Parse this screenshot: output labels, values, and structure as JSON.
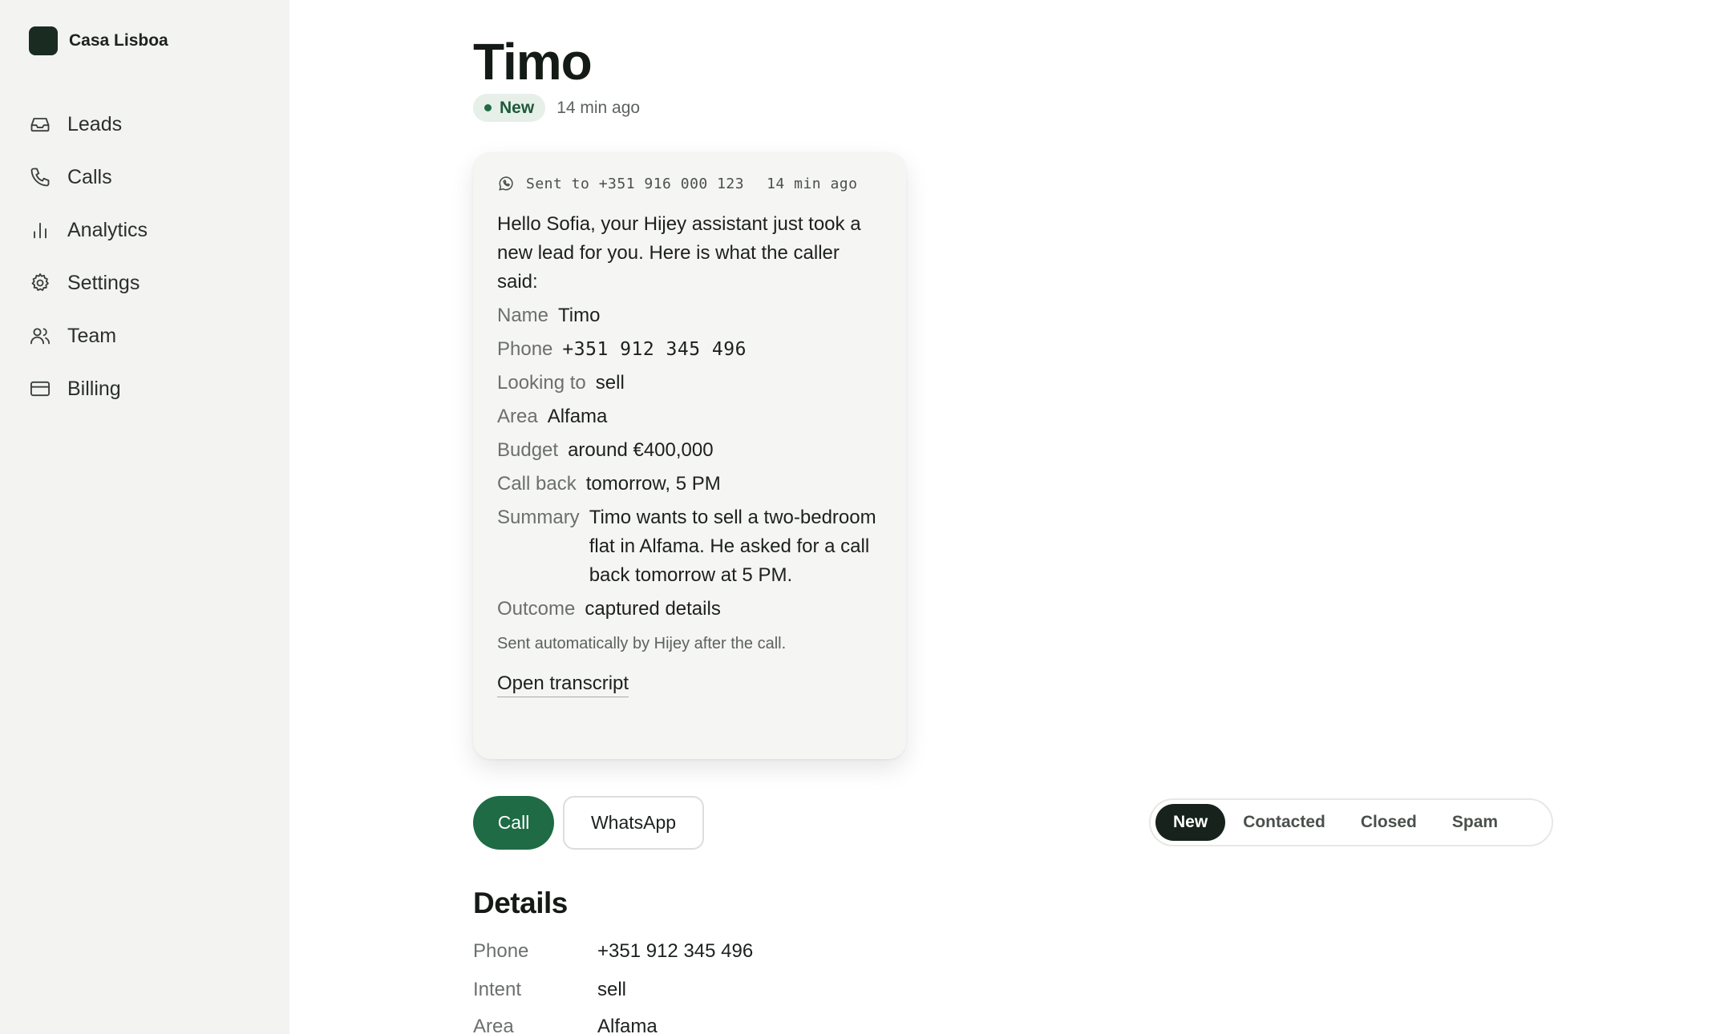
{
  "brand": {
    "name": "Casa Lisboa"
  },
  "nav": [
    {
      "label": "Leads",
      "icon": "inbox-icon"
    },
    {
      "label": "Calls",
      "icon": "phone-icon"
    },
    {
      "label": "Analytics",
      "icon": "bar-chart-icon"
    },
    {
      "label": "Settings",
      "icon": "gear-icon"
    },
    {
      "label": "Team",
      "icon": "users-icon"
    },
    {
      "label": "Billing",
      "icon": "credit-card-icon"
    }
  ],
  "lead": {
    "name": "Timo",
    "status": "New",
    "time_ago": "14 min ago"
  },
  "message": {
    "sent_to": "Sent to +351 916 000 123",
    "time": "14 min ago",
    "intro": "Hello Sofia, your Hijey assistant just took a new lead for you. Here is what the caller said:",
    "fields": [
      {
        "label": "Name",
        "value": "Timo"
      },
      {
        "label": "Phone",
        "value": "+351 912 345 496"
      },
      {
        "label": "Looking to",
        "value": "sell"
      },
      {
        "label": "Area",
        "value": "Alfama"
      },
      {
        "label": "Budget",
        "value": "around €400,000"
      },
      {
        "label": "Call back",
        "value": "tomorrow, 5 PM"
      },
      {
        "label": "Summary",
        "value": "Timo wants to sell a two-bedroom flat in Alfama. He asked for a call back tomorrow at 5 PM."
      },
      {
        "label": "Outcome",
        "value": "captured details"
      }
    ],
    "note": "Sent automatically by Hijey after the call.",
    "link": "Open transcript"
  },
  "actions": {
    "call": "Call",
    "whatsapp": "WhatsApp"
  },
  "status_options": [
    "New",
    "Contacted",
    "Closed",
    "Spam"
  ],
  "status_selected": "New",
  "details": {
    "title": "Details",
    "rows": [
      {
        "label": "Phone",
        "value": "+351 912 345 496"
      },
      {
        "label": "Intent",
        "value": "sell"
      },
      {
        "label": "Area",
        "value": "Alfama"
      }
    ]
  },
  "colors": {
    "accent": "#1e6b45",
    "sidebar_bg": "#f3f3f1",
    "status_pill_bg": "#e6efe8",
    "segment_active": "#16221b"
  }
}
